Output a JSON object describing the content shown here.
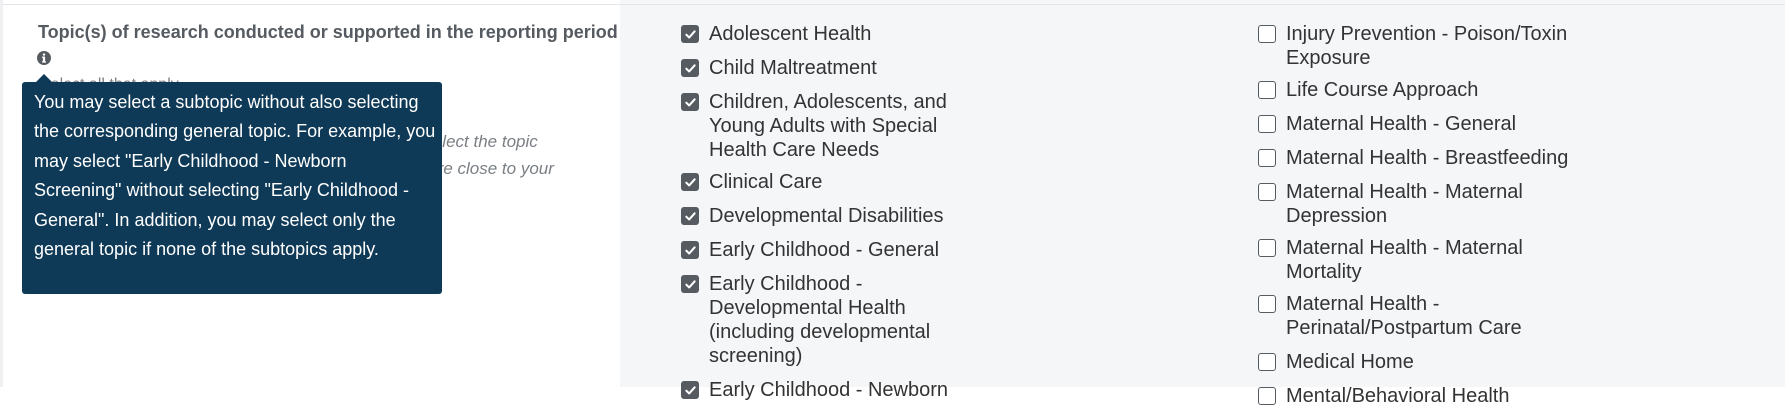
{
  "field": {
    "label": "Topic(s) of research conducted or supported in the reporting period",
    "hint_partial": "Select all that apply.",
    "help_lines": [
      "ed, select the topic",
      "s are close to your"
    ]
  },
  "tooltip": {
    "text": "You may select a subtopic without also selecting the corresponding general topic. For example, you may select \"Early Childhood - Newborn Screening\" without selecting \"Early Childhood - General\". In addition, you may select only the general topic if none of the subtopics apply."
  },
  "topics_left": [
    {
      "label": "Adolescent Health",
      "checked": true
    },
    {
      "label": "Child Maltreatment",
      "checked": true
    },
    {
      "label": "Children, Adolescents, and Young Adults with Special Health Care Needs",
      "checked": true
    },
    {
      "label": "Clinical Care",
      "checked": true
    },
    {
      "label": "Developmental Disabilities",
      "checked": true
    },
    {
      "label": "Early Childhood - General",
      "checked": true
    },
    {
      "label": "Early Childhood - Developmental Health (including developmental screening)",
      "checked": true
    },
    {
      "label": "Early Childhood - Newborn",
      "checked": true
    }
  ],
  "topics_right": [
    {
      "label": "Injury Prevention - Poison/Toxin Exposure",
      "checked": false
    },
    {
      "label": "Life Course Approach",
      "checked": false
    },
    {
      "label": "Maternal Health - General",
      "checked": false
    },
    {
      "label": "Maternal Health - Breastfeeding",
      "checked": false
    },
    {
      "label": "Maternal Health - Maternal Depression",
      "checked": false
    },
    {
      "label": "Maternal Health - Maternal Mortality",
      "checked": false
    },
    {
      "label": "Maternal Health - Perinatal/Postpartum Care",
      "checked": false
    },
    {
      "label": "Medical Home",
      "checked": false
    },
    {
      "label": "Mental/Behavioral Health",
      "checked": false
    }
  ],
  "colors": {
    "tooltip_bg": "#0f3a57",
    "checkbox": "#555b61",
    "panel_bg": "#f5f6f8"
  }
}
